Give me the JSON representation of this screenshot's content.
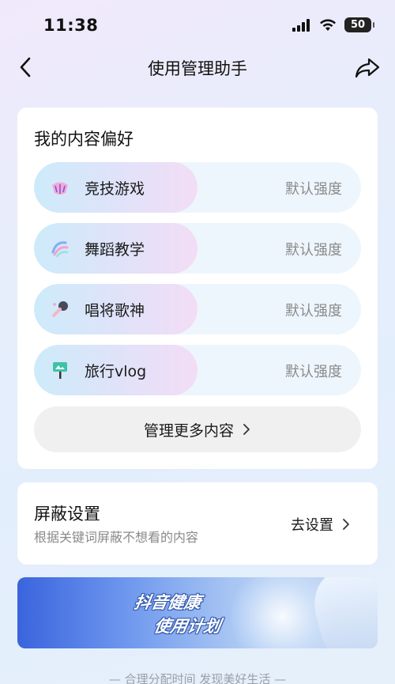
{
  "status": {
    "time": "11:38",
    "battery": "50"
  },
  "nav": {
    "title": "使用管理助手"
  },
  "preferences": {
    "title": "我的内容偏好",
    "items": [
      {
        "label": "竞技游戏",
        "strength": "默认强度",
        "icon": "game-shell-icon"
      },
      {
        "label": "舞蹈教学",
        "strength": "默认强度",
        "icon": "dance-ribbon-icon"
      },
      {
        "label": "唱将歌神",
        "strength": "默认强度",
        "icon": "microphone-icon"
      },
      {
        "label": "旅行vlog",
        "strength": "默认强度",
        "icon": "selfie-stick-icon"
      }
    ],
    "manage_more": "管理更多内容"
  },
  "block_settings": {
    "title": "屏蔽设置",
    "subtitle": "根据关键词屏蔽不想看的内容",
    "action": "去设置"
  },
  "banner": {
    "line1": "抖音健康",
    "line2": "使用计划"
  },
  "footer": "— 合理分配时间 发现美好生活 —",
  "colors": {
    "accent_fill_start": "#cdebfa",
    "accent_fill_end": "#f2ddf5",
    "secondary_text": "#8a8a8a"
  }
}
